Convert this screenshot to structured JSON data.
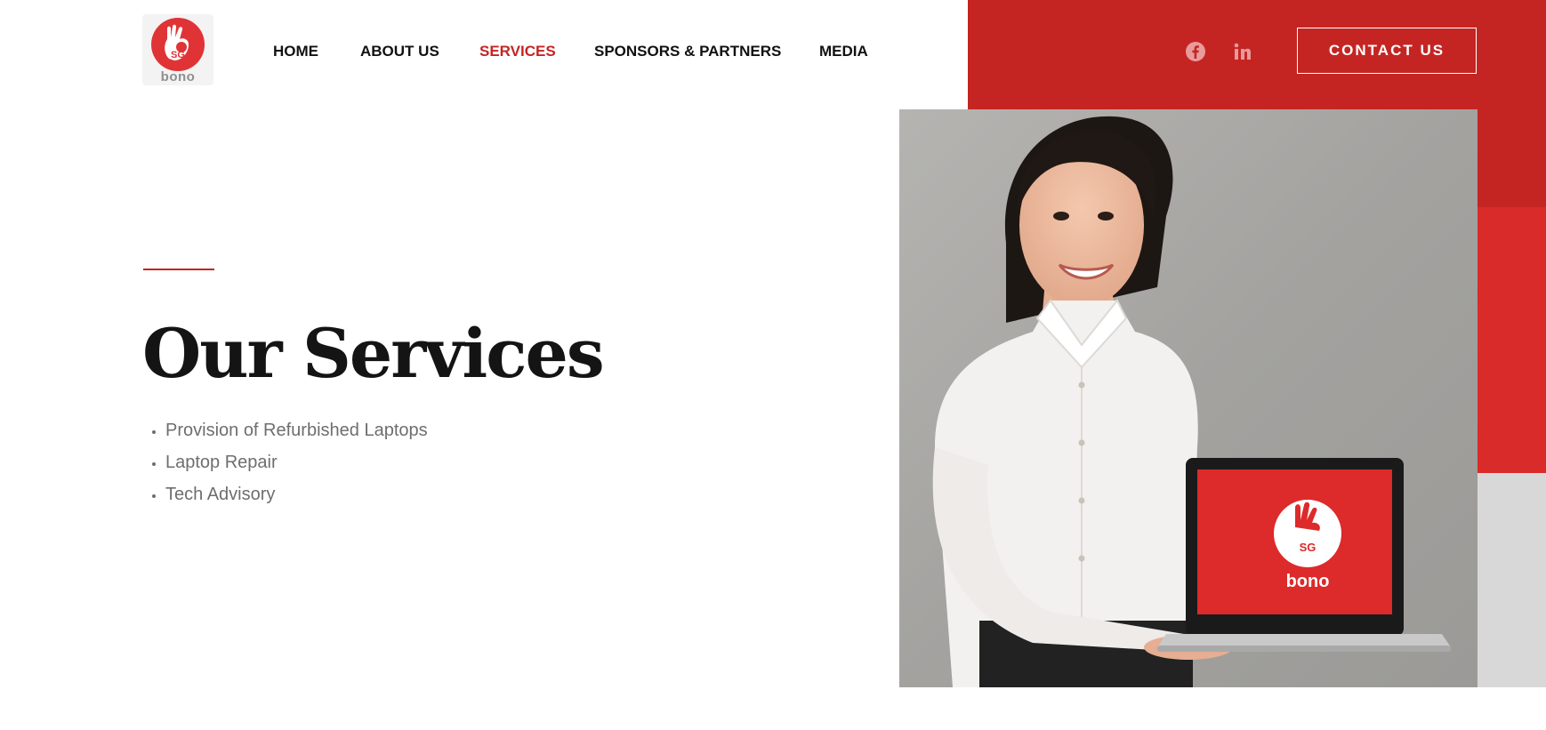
{
  "brand": {
    "logo_text": "bono",
    "logo_badge": "SG"
  },
  "nav": {
    "items": [
      {
        "label": "HOME"
      },
      {
        "label": "ABOUT US"
      },
      {
        "label": "SERVICES"
      },
      {
        "label": "SPONSORS & PARTNERS"
      },
      {
        "label": "MEDIA"
      }
    ],
    "active_index": 2
  },
  "social": {
    "icons": [
      "facebook-icon",
      "linkedin-icon"
    ]
  },
  "header": {
    "contact_label": "CONTACT US"
  },
  "hero": {
    "title": "Our Services",
    "services": [
      "Provision of Refurbished Laptops",
      "Laptop Repair",
      "Tech Advisory"
    ],
    "laptop_screen_brand": "bono",
    "laptop_screen_badge": "SG"
  },
  "colors": {
    "brand_red": "#c42523",
    "accent_red": "#d92b2a",
    "text_dark": "#141414",
    "text_muted": "#6e6e6e"
  }
}
